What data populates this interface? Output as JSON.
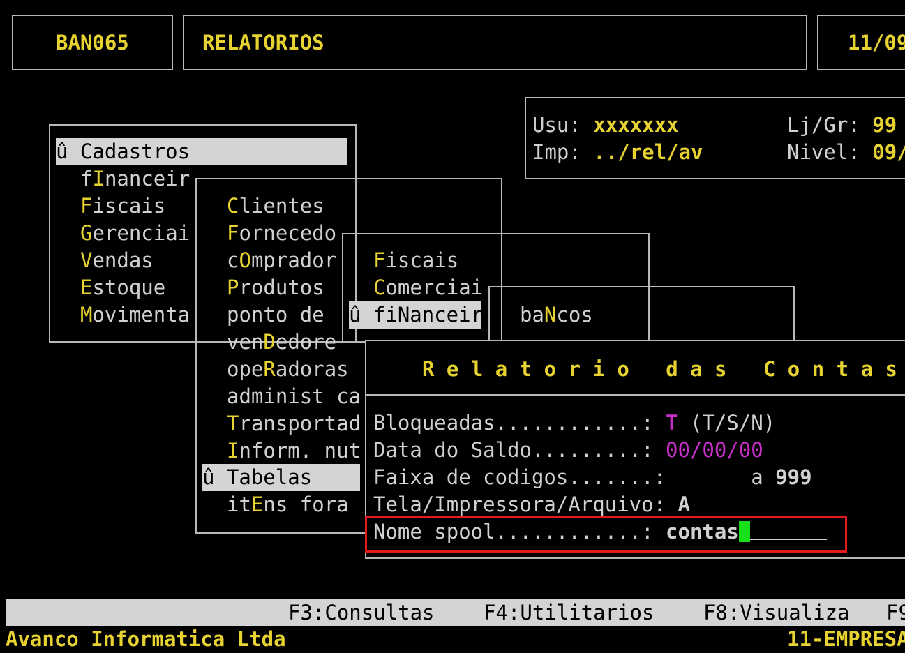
{
  "header": {
    "program_code": "BAN065",
    "section_title": "RELATORIOS",
    "date_partial": "11/09"
  },
  "user_info": {
    "usu_label": "Usu:",
    "usu_value": "xxxxxxx",
    "imp_label": "Imp:",
    "imp_value": "../rel/av",
    "ljgr_label": "Lj/Gr:",
    "ljgr_value": "99",
    "nivel_label": "Nivel:",
    "nivel_value": "09/"
  },
  "menu1": {
    "selected": "û Cadastros",
    "items": [
      {
        "pre": "f",
        "key": "I",
        "post": "nanceir"
      },
      {
        "pre": "",
        "key": "F",
        "post": "iscais"
      },
      {
        "pre": "",
        "key": "G",
        "post": "erenciai"
      },
      {
        "pre": "",
        "key": "V",
        "post": "endas"
      },
      {
        "pre": "",
        "key": "E",
        "post": "stoque"
      },
      {
        "pre": "",
        "key": "M",
        "post": "ovimenta"
      }
    ]
  },
  "menu2": {
    "items": [
      {
        "pre": "",
        "key": "C",
        "post": "lientes"
      },
      {
        "pre": "",
        "key": "F",
        "post": "ornecedo"
      },
      {
        "pre": "c",
        "key": "O",
        "post": "mprador"
      },
      {
        "pre": "",
        "key": "P",
        "post": "rodutos"
      },
      {
        "pre": "ponto de",
        "key": "",
        "post": ""
      },
      {
        "pre": "ven",
        "key": "D",
        "post": "edore"
      },
      {
        "pre": "ope",
        "key": "R",
        "post": "adoras"
      },
      {
        "pre": "administ ca",
        "key": "",
        "post": ""
      },
      {
        "pre": "",
        "key": "T",
        "post": "ransportad"
      },
      {
        "pre": "",
        "key": "I",
        "post": "nform. nut"
      }
    ],
    "selected": "û Tabelas",
    "last": {
      "pre": "it",
      "key": "E",
      "post": "ns fora"
    }
  },
  "menu3": {
    "items": [
      {
        "pre": "",
        "key": "F",
        "post": "iscais"
      },
      {
        "pre": "",
        "key": "C",
        "post": "omerciai"
      }
    ],
    "selected": "û fiNanceir"
  },
  "menu4": {
    "item": {
      "pre": "ba",
      "key": "N",
      "post": "cos"
    }
  },
  "dialog": {
    "title": "R e l a t o r i o   d a s   C o n t a s",
    "fields": {
      "bloqueadas_label": "Bloqueadas............: ",
      "bloqueadas_value": "T",
      "bloqueadas_hint": " (T/S/N)",
      "data_label": "Data do Saldo.........: ",
      "data_value": "00/00/00",
      "faixa_label": "Faixa de codigos.......: ",
      "faixa_sep": "a",
      "faixa_value": "999",
      "tela_label": "Tela/Impressora/Arquivo: ",
      "tela_value": "A",
      "nome_label": "Nome spool............: ",
      "nome_value": "contas"
    }
  },
  "function_bar": {
    "f3": "F3:Consultas",
    "f4": "F4:Utilitarios",
    "f8": "F8:Visualiza",
    "f9": "F9"
  },
  "status": {
    "company": "Avanco Informatica Ltda",
    "empresa": "11-EMPRESA"
  },
  "colors": {
    "background": "#000000",
    "text": "#d0d0d0",
    "highlight": "#e6d230",
    "magenta": "#c82fc8",
    "cursor": "#18e018",
    "focus_border": "#e01c1c",
    "bar": "#d4d4d4"
  }
}
